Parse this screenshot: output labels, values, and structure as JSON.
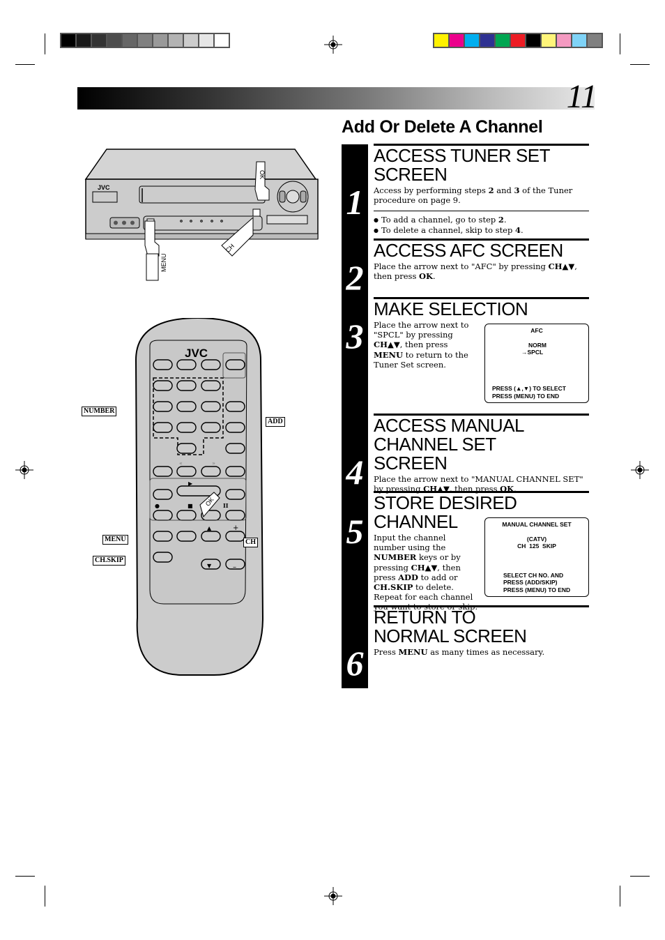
{
  "page": {
    "number": "11",
    "section_title": "Add Or Delete A Channel"
  },
  "print_marks": {
    "grayscale_swatches": [
      "#000000",
      "#1a1a1a",
      "#333333",
      "#4d4d4d",
      "#666666",
      "#808080",
      "#999999",
      "#b3b3b3",
      "#cccccc",
      "#e6e6e6",
      "#ffffff"
    ],
    "color_swatches": [
      "#fff200",
      "#ec008c",
      "#00aeef",
      "#2e3192",
      "#00a651",
      "#ed1c24",
      "#000000",
      "#fff57a",
      "#f49ac1",
      "#7fd3f7",
      "#808080"
    ]
  },
  "illustrations": {
    "vcr": {
      "brand": "JVC",
      "hand_labels": {
        "ok": "OK",
        "menu": "MENU",
        "ch": "CH"
      }
    },
    "remote": {
      "brand": "JVC",
      "callouts": {
        "number": "NUMBER",
        "add": "ADD",
        "menu": "MENU",
        "ch_skip": "CH.SKIP",
        "ch": "CH",
        "ok": "OK"
      },
      "symbols": {
        "rew": "«",
        "ff": "»",
        "play": "▶",
        "rec": "●",
        "stop": "■",
        "pause": "II",
        "up": "▲",
        "down": "▼",
        "plus": "+",
        "minus": "–"
      }
    }
  },
  "steps": [
    {
      "number": "1",
      "title": "ACCESS TUNER SET SCREEN",
      "text_parts": [
        "Access by performing steps ",
        "2",
        " and ",
        "3",
        " of the Tuner procedure on page 9."
      ],
      "bullets": [
        {
          "pre": "To add a channel, go to step ",
          "bold": "2",
          "post": "."
        },
        {
          "pre": "To delete a channel, skip to step ",
          "bold": "4",
          "post": "."
        }
      ]
    },
    {
      "number": "2",
      "title": "ACCESS AFC SCREEN",
      "text_parts": [
        "Place the arrow next to \"AFC\" by pressing ",
        "CH▲▼",
        ", then press ",
        "OK",
        "."
      ]
    },
    {
      "number": "3",
      "title": "MAKE SELECTION",
      "text_parts": [
        "Place the arrow next to \"SPCL\" by pressing ",
        "CH▲▼",
        ", then press ",
        "MENU",
        " to return to the Tuner Set screen."
      ],
      "osd": {
        "title": "AFC",
        "options": [
          "NORM",
          "SPCL"
        ],
        "selected_marker": "→",
        "footer": [
          "PRESS (▲,▼) TO SELECT",
          "PRESS (MENU) TO END"
        ]
      }
    },
    {
      "number": "4",
      "title": "ACCESS MANUAL CHANNEL SET SCREEN",
      "text_parts": [
        "Place the arrow next to \"MANUAL CHANNEL SET\" by pressing ",
        "CH▲▼",
        ", then press ",
        "OK",
        "."
      ]
    },
    {
      "number": "5",
      "title": "STORE DESIRED CHANNEL",
      "text_parts": [
        "Input the channel number using the ",
        "NUMBER",
        " keys or by pressing ",
        "CH▲▼",
        ", then press ",
        "ADD",
        " to add or ",
        "CH.SKIP",
        " to delete. Repeat for each channel you want to store or skip."
      ],
      "osd": {
        "title": "MANUAL CHANNEL SET",
        "lines": [
          "(CATV)",
          "CH  125  SKIP"
        ],
        "footer": [
          "SELECT CH NO. AND",
          "PRESS (ADD/SKIP)",
          "PRESS (MENU) TO END"
        ]
      }
    },
    {
      "number": "6",
      "title": "RETURN TO NORMAL SCREEN",
      "text_parts": [
        "Press ",
        "MENU",
        " as many times as necessary."
      ]
    }
  ]
}
